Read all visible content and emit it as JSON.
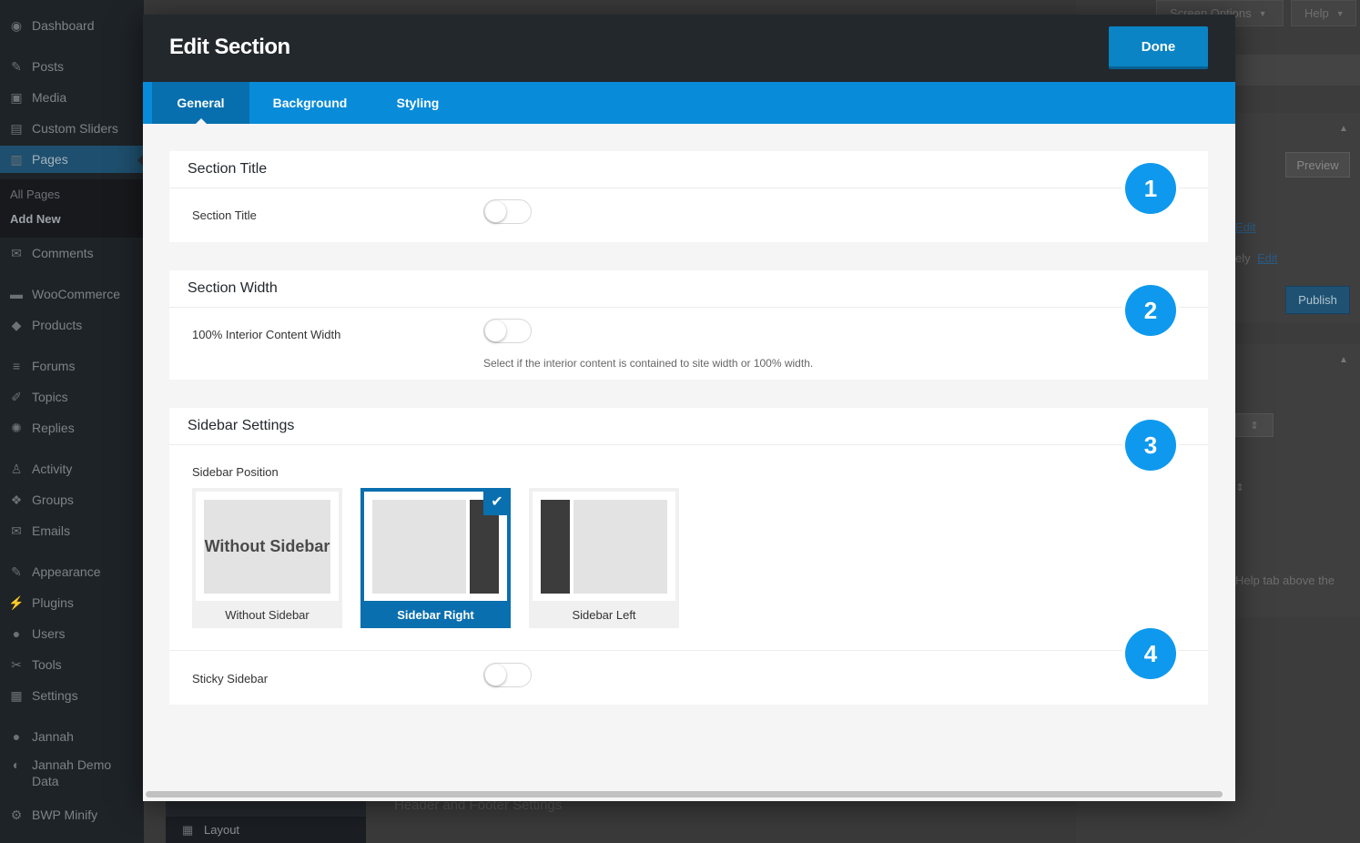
{
  "admin_menu": {
    "items": [
      {
        "label": "Dashboard",
        "icon": "dashboard-icon",
        "glyph": "◉"
      },
      {
        "label": "Posts",
        "icon": "pin-icon",
        "glyph": "✎"
      },
      {
        "label": "Media",
        "icon": "media-icon",
        "glyph": "▣"
      },
      {
        "label": "Custom Sliders",
        "icon": "slider-icon",
        "glyph": "▤"
      },
      {
        "label": "Pages",
        "icon": "pages-icon",
        "glyph": "▥"
      },
      {
        "label": "Comments",
        "icon": "comment-icon",
        "glyph": "✉"
      },
      {
        "label": "WooCommerce",
        "icon": "woo-icon",
        "glyph": "▬"
      },
      {
        "label": "Products",
        "icon": "products-icon",
        "glyph": "◆"
      },
      {
        "label": "Forums",
        "icon": "forums-icon",
        "glyph": "≡"
      },
      {
        "label": "Topics",
        "icon": "topics-icon",
        "glyph": "✐"
      },
      {
        "label": "Replies",
        "icon": "replies-icon",
        "glyph": "✺"
      },
      {
        "label": "Activity",
        "icon": "activity-icon",
        "glyph": "♙"
      },
      {
        "label": "Groups",
        "icon": "groups-icon",
        "glyph": "❖"
      },
      {
        "label": "Emails",
        "icon": "email-icon",
        "glyph": "✉"
      },
      {
        "label": "Appearance",
        "icon": "appearance-icon",
        "glyph": "✎"
      },
      {
        "label": "Plugins",
        "icon": "plugins-icon",
        "glyph": "⚡"
      },
      {
        "label": "Users",
        "icon": "users-icon",
        "glyph": "●"
      },
      {
        "label": "Tools",
        "icon": "tools-icon",
        "glyph": "✂"
      },
      {
        "label": "Settings",
        "icon": "settings-icon",
        "glyph": "▦"
      },
      {
        "label": "Jannah",
        "icon": "jannah-icon",
        "glyph": "●"
      },
      {
        "label": "Jannah Demo Data",
        "icon": "demo-data-icon",
        "glyph": "◐"
      },
      {
        "label": "BWP Minify",
        "icon": "minify-icon",
        "glyph": "⚙"
      }
    ],
    "submenu": {
      "all_pages": "All Pages",
      "add_new": "Add New"
    }
  },
  "background_page": {
    "screen_options": "Screen Options",
    "help": "Help",
    "preview": "Preview",
    "edit_link_1": "Edit",
    "immediately_prefix": "ely",
    "edit_link_2": "Edit",
    "publish": "Publish",
    "help_text": "Help tab above the",
    "header_footer": "Header and Footer Settings",
    "layout": "Layout"
  },
  "modal": {
    "title": "Edit Section",
    "done": "Done",
    "tabs": [
      "General",
      "Background",
      "Styling"
    ],
    "sections": {
      "title": {
        "heading": "Section Title",
        "option_label": "Section Title",
        "enabled": false
      },
      "width": {
        "heading": "Section Width",
        "option_label": "100% Interior Content Width",
        "hint": "Select if the interior content is contained to site width or 100% width.",
        "enabled": false
      },
      "sidebar": {
        "heading": "Sidebar Settings",
        "position_label": "Sidebar Position",
        "options": [
          {
            "caption": "Without Sidebar",
            "thumb_text": "Without Sidebar"
          },
          {
            "caption": "Sidebar Right"
          },
          {
            "caption": "Sidebar Left"
          }
        ],
        "selected": "Sidebar Right",
        "sticky_label": "Sticky Sidebar",
        "sticky_enabled": false
      }
    },
    "badges": [
      "1",
      "2",
      "3",
      "4"
    ]
  },
  "colors": {
    "accent": "#088bd9",
    "accent_dark": "#0a6fae",
    "header_bg": "#23282d",
    "badge": "#0e99ee"
  }
}
